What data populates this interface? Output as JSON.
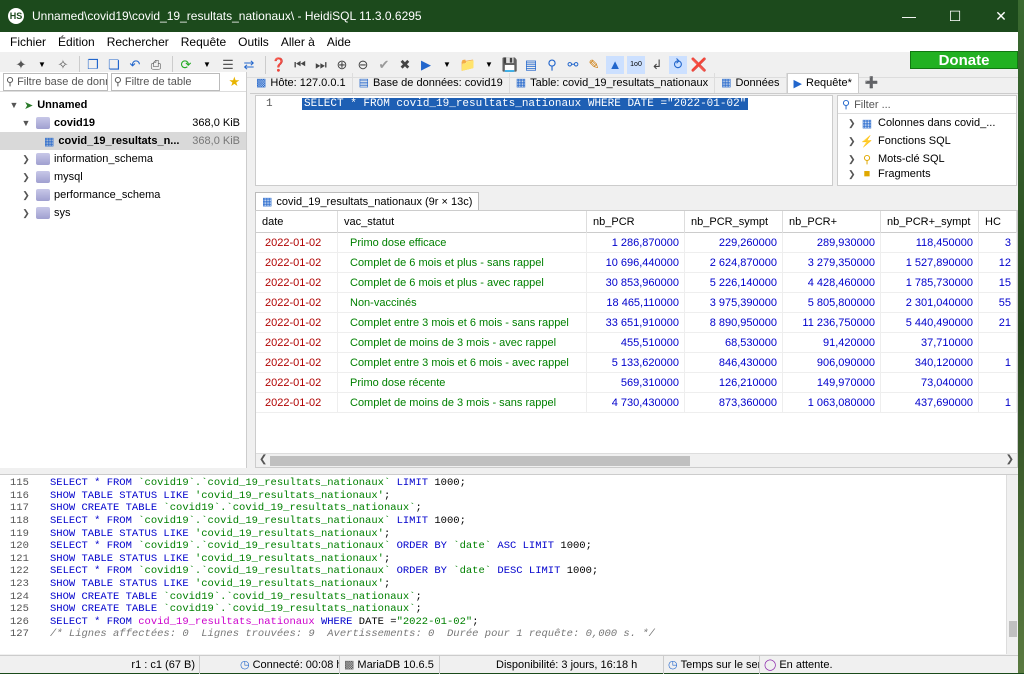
{
  "window": {
    "title": "Unnamed\\covid19\\covid_19_resultats_nationaux\\ - HeidiSQL 11.3.0.6295",
    "app_icon": "HS"
  },
  "menu": [
    "Fichier",
    "Édition",
    "Rechercher",
    "Requête",
    "Outils",
    "Aller à",
    "Aide"
  ],
  "donate_label": "Donate",
  "left_panel": {
    "filter_db_placeholder": "Filtre base de donr",
    "filter_table_placeholder": "Filtre de table",
    "tree": [
      {
        "label": "Unnamed",
        "level": 0,
        "expanded": true,
        "size": ""
      },
      {
        "label": "covid19",
        "level": 1,
        "expanded": true,
        "size": "368,0 KiB"
      },
      {
        "label": "covid_19_resultats_n...",
        "level": 2,
        "expanded": false,
        "size": "368,0 KiB"
      },
      {
        "label": "information_schema",
        "level": 1,
        "expanded": false,
        "size": ""
      },
      {
        "label": "mysql",
        "level": 1,
        "expanded": false,
        "size": ""
      },
      {
        "label": "performance_schema",
        "level": 1,
        "expanded": false,
        "size": ""
      },
      {
        "label": "sys",
        "level": 1,
        "expanded": false,
        "size": ""
      }
    ]
  },
  "tabs": [
    {
      "label": "Hôte: 127.0.0.1",
      "icon": "host-icon"
    },
    {
      "label": "Base de données: covid19",
      "icon": "database-icon"
    },
    {
      "label": "Table: covid_19_resultats_nationaux",
      "icon": "table-icon"
    },
    {
      "label": "Données",
      "icon": "grid-icon"
    },
    {
      "label": "Requête*",
      "icon": "play-icon"
    }
  ],
  "editor": {
    "line": "1",
    "query": "SELECT * FROM covid_19_resultats_nationaux WHERE DATE =\"2022-01-02\""
  },
  "helper": {
    "filter_placeholder": "Filter ...",
    "items": [
      {
        "label": "Colonnes dans covid_...",
        "icon": "columns-icon"
      },
      {
        "label": "Fonctions SQL",
        "icon": "function-icon"
      },
      {
        "label": "Mots-clé SQL",
        "icon": "key-icon"
      },
      {
        "label": "Fragments",
        "icon": "folder-icon"
      }
    ]
  },
  "result_tab": "covid_19_resultats_nationaux (9r × 13c)",
  "grid": {
    "columns": [
      "date",
      "vac_statut",
      "nb_PCR",
      "nb_PCR_sympt",
      "nb_PCR+",
      "nb_PCR+_sympt",
      "HC"
    ],
    "rows": [
      [
        "2022-01-02",
        "Primo dose efficace",
        "1 286,870000",
        "229,260000",
        "289,930000",
        "118,450000",
        "3"
      ],
      [
        "2022-01-02",
        "Complet de 6 mois et plus - sans rappel",
        "10 696,440000",
        "2 624,870000",
        "3 279,350000",
        "1 527,890000",
        "12"
      ],
      [
        "2022-01-02",
        "Complet de 6 mois et plus - avec rappel",
        "30 853,960000",
        "5 226,140000",
        "4 428,460000",
        "1 785,730000",
        "15"
      ],
      [
        "2022-01-02",
        "Non-vaccinés",
        "18 465,110000",
        "3 975,390000",
        "5 805,800000",
        "2 301,040000",
        "55"
      ],
      [
        "2022-01-02",
        "Complet entre 3 mois et 6 mois - sans rappel",
        "33 651,910000",
        "8 890,950000",
        "11 236,750000",
        "5 440,490000",
        "21"
      ],
      [
        "2022-01-02",
        "Complet de moins de 3 mois - avec rappel",
        "455,510000",
        "68,530000",
        "91,420000",
        "37,710000",
        ""
      ],
      [
        "2022-01-02",
        "Complet entre 3 mois et 6 mois - avec rappel",
        "5 133,620000",
        "846,430000",
        "906,090000",
        "340,120000",
        "1"
      ],
      [
        "2022-01-02",
        "Primo dose récente",
        "569,310000",
        "126,210000",
        "149,970000",
        "73,040000",
        ""
      ],
      [
        "2022-01-02",
        "Complet de moins de 3 mois - sans rappel",
        "4 730,430000",
        "873,360000",
        "1 063,080000",
        "437,690000",
        "1"
      ]
    ]
  },
  "log": [
    {
      "n": "115",
      "parts": [
        [
          "kw",
          "SELECT * FROM "
        ],
        [
          "str",
          "`covid19`.`covid_19_resultats_nationaux`"
        ],
        [
          "kw",
          " LIMIT "
        ],
        [
          "",
          "1000;"
        ]
      ]
    },
    {
      "n": "116",
      "parts": [
        [
          "kw",
          "SHOW TABLE STATUS LIKE "
        ],
        [
          "str",
          "'covid_19_resultats_nationaux'"
        ],
        [
          "",
          ";"
        ]
      ]
    },
    {
      "n": "117",
      "parts": [
        [
          "kw",
          "SHOW CREATE TABLE "
        ],
        [
          "str",
          "`covid19`.`covid_19_resultats_nationaux`"
        ],
        [
          "",
          ";"
        ]
      ]
    },
    {
      "n": "118",
      "parts": [
        [
          "kw",
          "SELECT * FROM "
        ],
        [
          "str",
          "`covid19`.`covid_19_resultats_nationaux`"
        ],
        [
          "kw",
          " LIMIT "
        ],
        [
          "",
          "1000;"
        ]
      ]
    },
    {
      "n": "119",
      "parts": [
        [
          "kw",
          "SHOW TABLE STATUS LIKE "
        ],
        [
          "str",
          "'covid_19_resultats_nationaux'"
        ],
        [
          "",
          ";"
        ]
      ]
    },
    {
      "n": "120",
      "parts": [
        [
          "kw",
          "SELECT * FROM "
        ],
        [
          "str",
          "`covid19`.`covid_19_resultats_nationaux`"
        ],
        [
          "kw",
          " ORDER BY "
        ],
        [
          "str",
          "`date`"
        ],
        [
          "kw",
          " ASC LIMIT "
        ],
        [
          "",
          "1000;"
        ]
      ]
    },
    {
      "n": "121",
      "parts": [
        [
          "kw",
          "SHOW TABLE STATUS LIKE "
        ],
        [
          "str",
          "'covid_19_resultats_nationaux'"
        ],
        [
          "",
          ";"
        ]
      ]
    },
    {
      "n": "122",
      "parts": [
        [
          "kw",
          "SELECT * FROM "
        ],
        [
          "str",
          "`covid19`.`covid_19_resultats_nationaux`"
        ],
        [
          "kw",
          " ORDER BY "
        ],
        [
          "str",
          "`date`"
        ],
        [
          "kw",
          " DESC LIMIT "
        ],
        [
          "",
          "1000;"
        ]
      ]
    },
    {
      "n": "123",
      "parts": [
        [
          "kw",
          "SHOW TABLE STATUS LIKE "
        ],
        [
          "str",
          "'covid_19_resultats_nationaux'"
        ],
        [
          "",
          ";"
        ]
      ]
    },
    {
      "n": "124",
      "parts": [
        [
          "kw",
          "SHOW CREATE TABLE "
        ],
        [
          "str",
          "`covid19`.`covid_19_resultats_nationaux`"
        ],
        [
          "",
          ";"
        ]
      ]
    },
    {
      "n": "125",
      "parts": [
        [
          "kw",
          "SHOW CREATE TABLE "
        ],
        [
          "str",
          "`covid19`.`covid_19_resultats_nationaux`"
        ],
        [
          "",
          ";"
        ]
      ]
    },
    {
      "n": "126",
      "parts": [
        [
          "kw",
          "SELECT * FROM "
        ],
        [
          "tbl",
          "covid_19_resultats_nationaux"
        ],
        [
          "kw",
          " WHERE "
        ],
        [
          "",
          "DATE ="
        ],
        [
          "str",
          "\"2022-01-02\""
        ],
        [
          "",
          ";"
        ]
      ]
    },
    {
      "n": "127",
      "parts": [
        [
          "cmt",
          "/* Lignes affectées: 0  Lignes trouvées: 9  Avertissements: 0  Durée pour 1 requête: 0,000 s. */"
        ]
      ]
    }
  ],
  "status": {
    "position": "r1 : c1 (67 B)",
    "connected": "Connecté: 00:08 h",
    "server": "MariaDB 10.6.5",
    "uptime": "Disponibilité: 3 jours, 16:18 h",
    "server_time": "Temps sur le serv",
    "state": "En attente."
  }
}
